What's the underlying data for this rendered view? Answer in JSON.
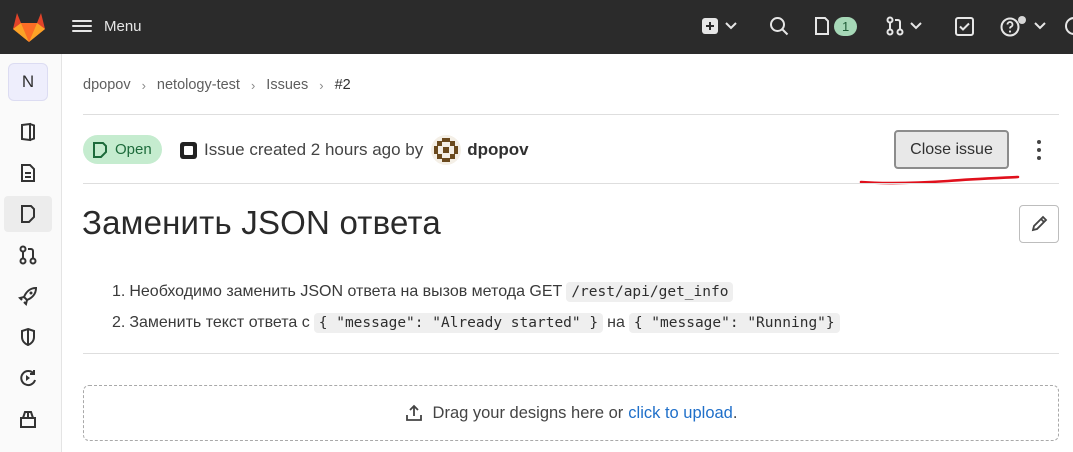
{
  "topbar": {
    "menu_label": "Menu",
    "todo_count": "1",
    "bg_color": "#2b2b2b",
    "icons": [
      "gitlab-logo",
      "hamburger-icon",
      "plus-square-icon",
      "search-icon",
      "issues-icon",
      "merge-request-icon",
      "todo-check-icon",
      "help-icon",
      "avatar-icon"
    ]
  },
  "sidebar": {
    "project_initial": "N",
    "items": [
      "project-overview-icon",
      "repository-icon",
      "issues-icon",
      "merge-requests-icon",
      "ci-cd-rocket-icon",
      "security-shield-icon",
      "deployments-icon",
      "packages-icon"
    ],
    "active_item": "issues-icon"
  },
  "breadcrumb": [
    "dpopov",
    "netology-test",
    "Issues",
    "#2"
  ],
  "issue": {
    "status": "Open",
    "created_text": "Issue created 2 hours ago by",
    "author": "dpopov",
    "close_label": "Close issue",
    "title": "Заменить JSON ответа",
    "description": [
      {
        "num": "1.",
        "text": "Необходимо заменить JSON ответа на вызов метода GET",
        "code1": "/rest/api/get_info"
      },
      {
        "num": "2.",
        "text": "Заменить текст ответа с",
        "code1": "{ \"message\": \"Already started\" }",
        "mid": "на",
        "code2": "{ \"message\": \"Running\"}"
      }
    ]
  },
  "dropzone": {
    "text": "Drag your designs here or",
    "link": "click to upload",
    "suffix": "."
  },
  "colors": {
    "open_badge_bg": "#c5eccf",
    "open_badge_text": "#1d6b3b",
    "link": "#1f6fc9",
    "annotation_red": "#e0101c"
  }
}
